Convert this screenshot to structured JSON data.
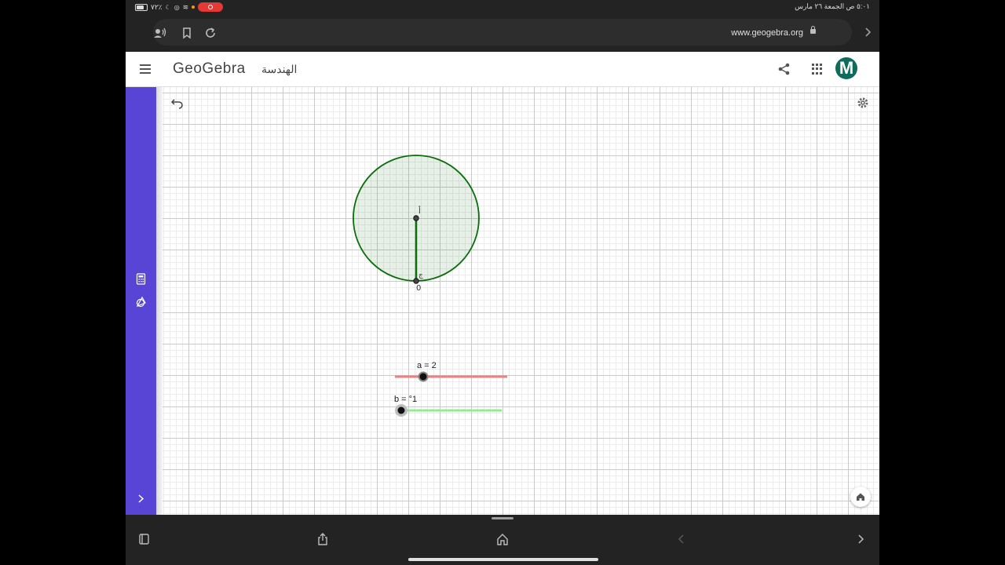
{
  "status_bar": {
    "battery_text": "٧٢٪",
    "datetime_text": "٥:٠١ ص  الجمعة ٢٦ مارس"
  },
  "browser": {
    "url": "www.geogebra.org"
  },
  "app": {
    "brand": "GeoGebra",
    "subtitle": "الهندسة",
    "avatar_letter": "M",
    "avatar_color": "#0f6b5c",
    "sidebar_color": "#5945d5"
  },
  "canvas": {
    "point_center_label": "أ",
    "point_edge_label": "ج",
    "origin_label": "0",
    "circle_color": "#0a6e0a",
    "slider_a": {
      "label": "a = 2",
      "value": 2,
      "color": "#f08080"
    },
    "slider_b": {
      "label": "b = °1",
      "value": 1,
      "color": "#90ee90"
    }
  },
  "icons": {
    "browser": [
      "speaker-icon",
      "bookmark-icon",
      "reload-icon",
      "lock-icon",
      "forward-icon"
    ],
    "app": [
      "menu-icon",
      "share-icon",
      "apps-grid-icon"
    ],
    "canvas": [
      "undo-icon",
      "settings-icon",
      "home-icon"
    ],
    "sidebar": [
      "calculator-icon",
      "geometry-tools-icon",
      "expand-icon"
    ],
    "bottom": [
      "tabs-icon",
      "share-sheet-icon",
      "home-icon",
      "back-icon",
      "forward-icon"
    ]
  }
}
